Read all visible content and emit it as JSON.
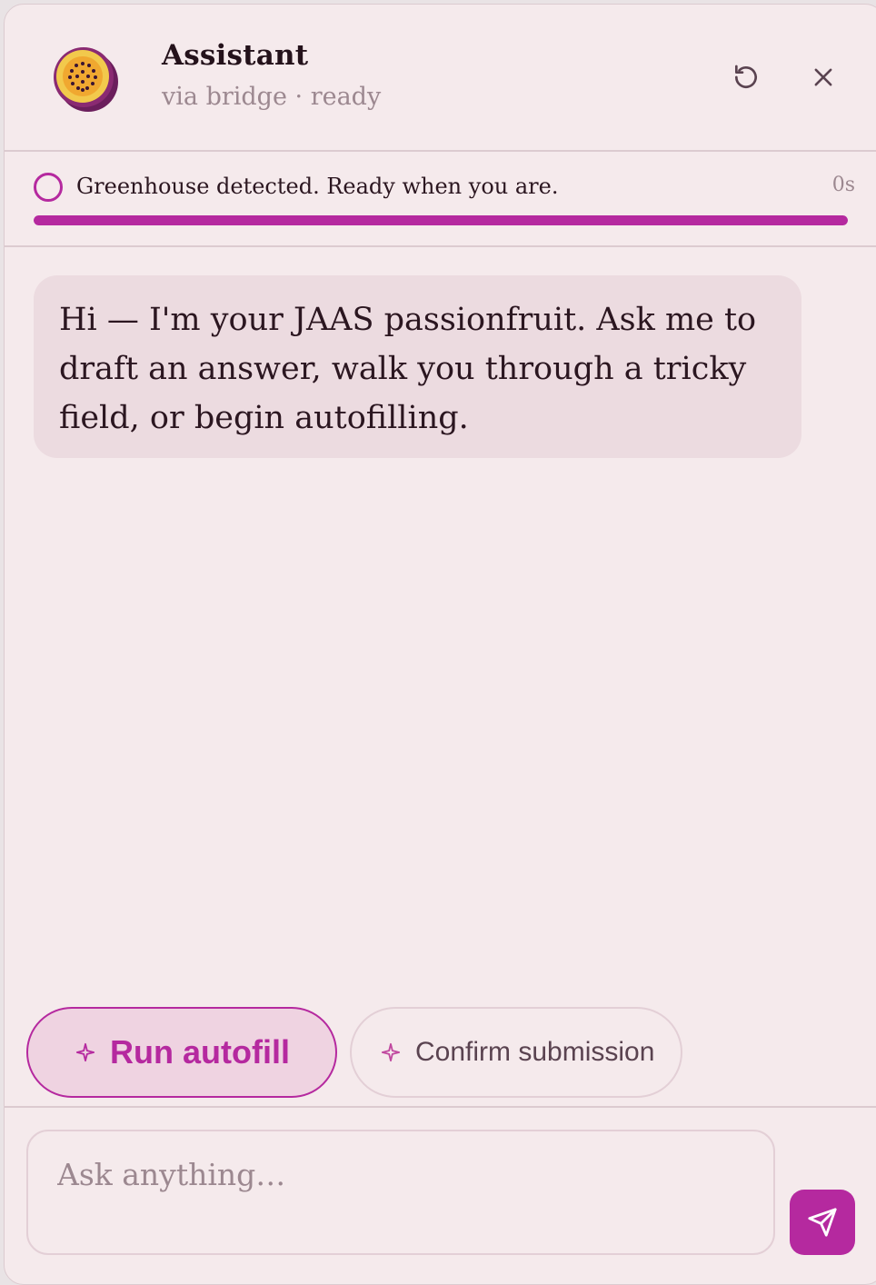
{
  "header": {
    "title": "Assistant",
    "subtitle": "via bridge · ready",
    "logo_icon": "passionfruit-icon",
    "refresh_icon": "refresh-icon",
    "close_icon": "close-icon"
  },
  "status": {
    "message": "Greenhouse detected. Ready when you are.",
    "elapsed": "0s",
    "progress_percent": 100
  },
  "messages": [
    {
      "role": "assistant",
      "text": "Hi — I'm your JAAS passionfruit. Ask me to draft an answer, walk you through a tricky field, or begin autofilling."
    }
  ],
  "actions": {
    "primary_label": "Run autofill",
    "secondary_label": "Confirm submission",
    "icon": "sparkle-icon"
  },
  "composer": {
    "placeholder": "Ask anything…",
    "value": "",
    "send_icon": "send-icon"
  },
  "colors": {
    "accent": "#b5299f",
    "background": "#f5eaec",
    "bubble": "#ecdbe0",
    "muted_text": "#9c8890"
  }
}
